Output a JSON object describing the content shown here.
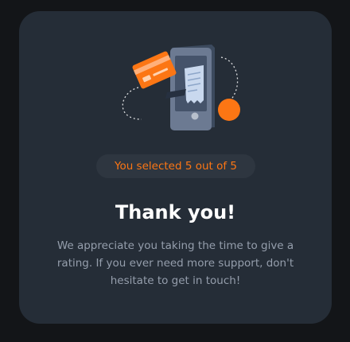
{
  "illustration": {
    "icon": "payment-phone-illustration",
    "accent_color": "#FC7614"
  },
  "rating": {
    "selected_text": "You selected 5 out of 5"
  },
  "thankyou": {
    "title": "Thank you!",
    "message": "We appreciate you taking the time to give a rating. If you ever need more support, don't hesitate to get in touch!"
  }
}
